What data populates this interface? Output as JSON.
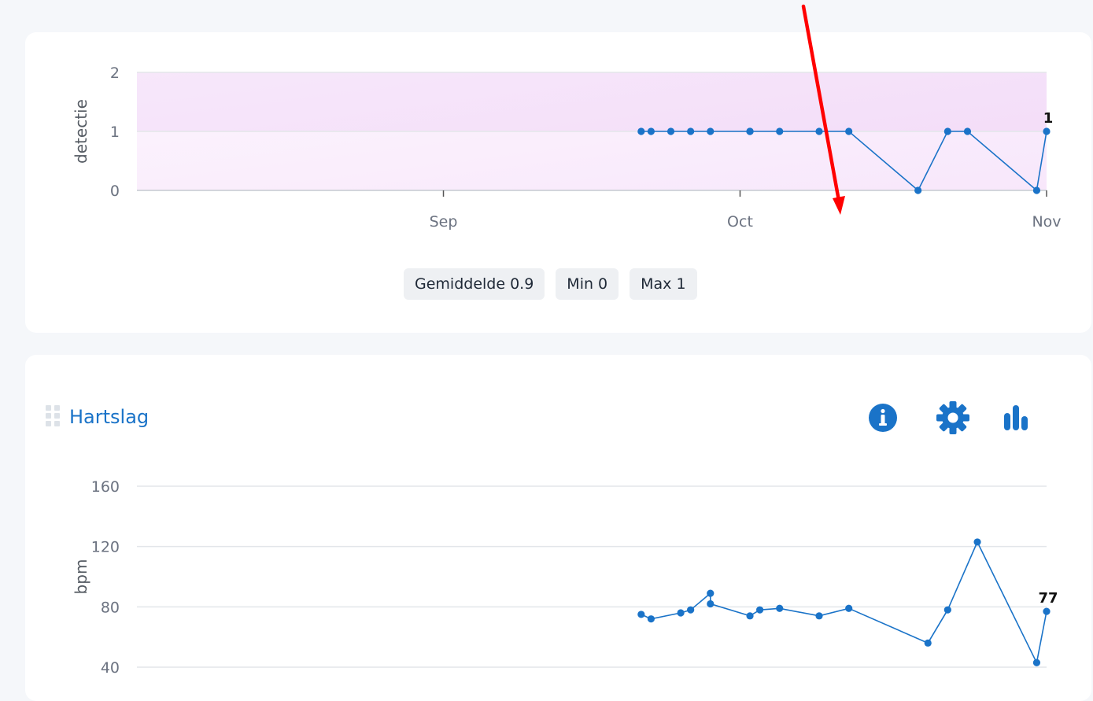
{
  "colors": {
    "series": "#1a73c8",
    "band_top": "#f1d6f7",
    "band_bottom": "#fbf0fd",
    "grid": "#e3e6ea",
    "axis": "#c9cdd3",
    "title": "#1a73c8",
    "annotation_arrow": "#ff0000"
  },
  "detectie_card": {
    "stats": {
      "mean": "Gemiddelde 0.9",
      "min": "Min 0",
      "max": "Max 1"
    }
  },
  "hartslag_card": {
    "title": "Hartslag",
    "icons": {
      "info": "info-icon",
      "settings": "gear-icon",
      "chart": "bar-chart-icon",
      "drag": "drag-handle-icon"
    }
  },
  "chart_data": [
    {
      "type": "line",
      "ylabel": "detectie",
      "ylim": [
        0,
        2
      ],
      "yticks": [
        0,
        1,
        2
      ],
      "xticks": [
        "Sep",
        "Oct",
        "Nov"
      ],
      "xlim": [
        "2024-08-01",
        "2024-11-01"
      ],
      "grid": true,
      "shaded_band": [
        0,
        2
      ],
      "last_value_label": "1",
      "x": [
        "2024-09-21",
        "2024-09-22",
        "2024-09-24",
        "2024-09-26",
        "2024-09-28",
        "2024-10-02",
        "2024-10-02",
        "2024-10-05",
        "2024-10-09",
        "2024-10-12",
        "2024-10-19",
        "2024-10-22",
        "2024-10-24",
        "2024-10-31",
        "2024-11-01"
      ],
      "values": [
        1,
        1,
        1,
        1,
        1,
        1,
        1,
        1,
        1,
        1,
        0,
        1,
        1,
        0,
        1
      ]
    },
    {
      "type": "line",
      "ylabel": "bpm",
      "ylim": [
        40,
        160
      ],
      "yticks": [
        40,
        80,
        120,
        160
      ],
      "xlim": [
        "2024-08-01",
        "2024-11-01"
      ],
      "grid": true,
      "last_value_label": "77",
      "x": [
        "2024-09-21",
        "2024-09-22",
        "2024-09-25",
        "2024-09-26",
        "2024-09-28",
        "2024-09-28",
        "2024-10-02",
        "2024-10-03",
        "2024-10-05",
        "2024-10-09",
        "2024-10-12",
        "2024-10-20",
        "2024-10-22",
        "2024-10-25",
        "2024-10-31",
        "2024-11-01"
      ],
      "values": [
        75,
        72,
        76,
        78,
        89,
        82,
        74,
        78,
        79,
        74,
        79,
        56,
        78,
        123,
        43,
        77
      ]
    }
  ]
}
